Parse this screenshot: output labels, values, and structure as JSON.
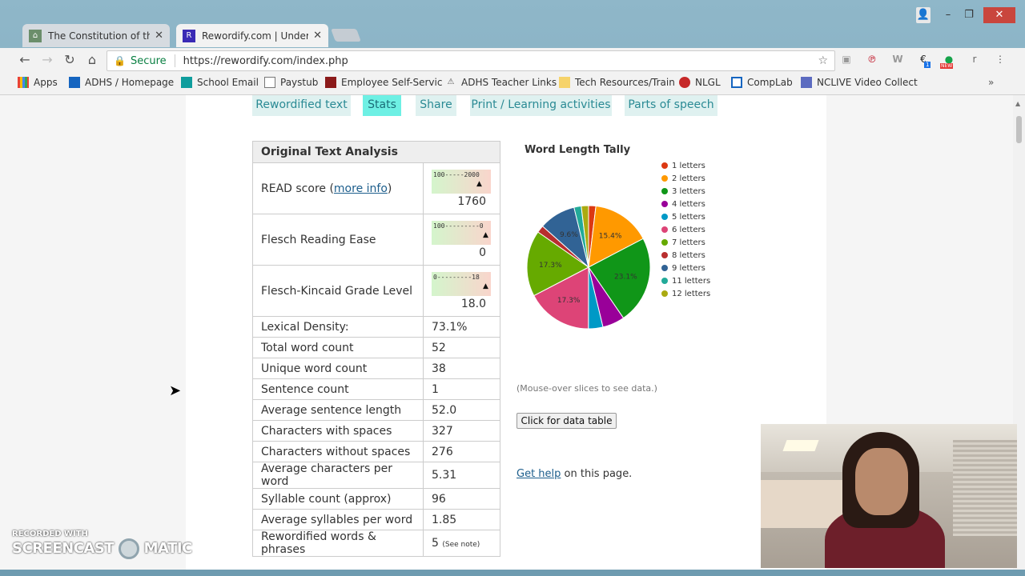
{
  "browser": {
    "tabs": [
      {
        "title": "The Constitution of the U",
        "active": false
      },
      {
        "title": "Rewordify.com | Underst",
        "active": true
      }
    ],
    "secure_label": "Secure",
    "url": "https://rewordify.com/index.php",
    "ext_new_badge": "NEW",
    "ext_badge_count": "1",
    "ext_r": "r"
  },
  "bookmarks": [
    {
      "label": "Apps"
    },
    {
      "label": "ADHS / Homepage"
    },
    {
      "label": "School Email"
    },
    {
      "label": "Paystub"
    },
    {
      "label": "Employee Self-Servic"
    },
    {
      "label": "ADHS Teacher Links"
    },
    {
      "label": "Tech Resources/Train"
    },
    {
      "label": "NLGL"
    },
    {
      "label": "CompLab"
    },
    {
      "label": "NCLIVE Video Collect"
    }
  ],
  "page_tabs": [
    {
      "label": "Rewordified text",
      "active": false
    },
    {
      "label": "Stats",
      "active": true
    },
    {
      "label": "Share",
      "active": false
    },
    {
      "label": "Print / Learning activities",
      "active": false
    },
    {
      "label": "Parts of speech",
      "active": false
    }
  ],
  "analysis": {
    "heading": "Original Text Analysis",
    "read": {
      "label_pre": "READ score (",
      "link": "more info",
      "label_post": ")",
      "scale": "100-----2000",
      "value": "1760",
      "position": 0.87
    },
    "flesch": {
      "label": "Flesch Reading Ease",
      "scale": "100---------0",
      "value": "0",
      "position": 1.0
    },
    "fk": {
      "label": "Flesch-Kincaid Grade Level",
      "scale": "0---------18",
      "value": "18.0",
      "position": 1.0
    },
    "rows": [
      {
        "label": "Lexical Density:",
        "value": "73.1%"
      },
      {
        "label": "Total word count",
        "value": "52"
      },
      {
        "label": "Unique word count",
        "value": "38"
      },
      {
        "label": "Sentence count",
        "value": "1"
      },
      {
        "label": "Average sentence length",
        "value": "52.0"
      },
      {
        "label": "Characters with spaces",
        "value": "327"
      },
      {
        "label": "Characters without spaces",
        "value": "276"
      },
      {
        "label": "Average characters per word",
        "value": "5.31"
      },
      {
        "label": "Syllable count (approx)",
        "value": "96"
      },
      {
        "label": "Average syllables per word",
        "value": "1.85"
      }
    ],
    "reworded": {
      "label": "Rewordified words & phrases",
      "value": "5",
      "note": "(See note)"
    }
  },
  "chart_data": {
    "type": "pie",
    "title": "Word Length Tally",
    "categories": [
      "1 letters",
      "2 letters",
      "3 letters",
      "4 letters",
      "5 letters",
      "6 letters",
      "7 letters",
      "8 letters",
      "9 letters",
      "11 letters",
      "12 letters"
    ],
    "values": [
      1.9,
      15.4,
      23.1,
      5.8,
      3.8,
      17.3,
      17.3,
      1.9,
      9.6,
      1.9,
      1.9
    ],
    "labels_shown": [
      "15.4%",
      "23.1%",
      "17.3%",
      "17.3%",
      "9.6%"
    ],
    "colors": [
      "#dc3912",
      "#ff9900",
      "#109618",
      "#990099",
      "#0099c6",
      "#dd4477",
      "#66aa00",
      "#b82e2e",
      "#316395",
      "#22aa99",
      "#aaaa11"
    ],
    "legend_position": "right"
  },
  "chart_hint": "(Mouse-over slices to see data.)",
  "data_table_button": "Click for data table",
  "help": {
    "link": "Get help",
    "text": " on this page."
  },
  "watermark": {
    "line1": "RECORDED WITH",
    "line2": "SCREENCAST",
    "line3": "MATIC"
  }
}
